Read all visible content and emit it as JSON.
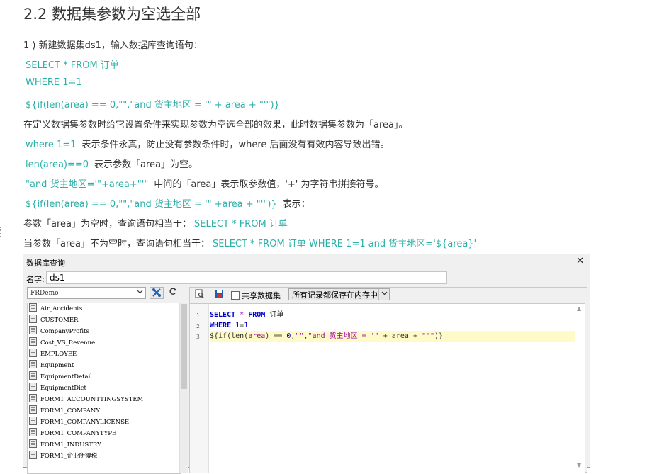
{
  "heading": "2.2 数据集参数为空选全部",
  "step1": "1 ) 新建数据集ds1，输入数据库查询语句：",
  "sql_lines": [
    "SELECT * FROM 订单",
    "WHERE 1=1",
    "${if(len(area) == 0,\"\",\"and 货主地区 = '\" + area + \"'\")}"
  ],
  "p_define": "在定义数据集参数时给它设置条件来实现参数为空选全部的效果，此时数据集参数为「area」。",
  "p_where_code": "where 1=1",
  "p_where_text": "表示条件永真，防止没有参数条件时，where 后面没有有效内容导致出错。",
  "p_len_code": "len(area)==0",
  "p_len_text": "表示参数「area」为空。",
  "p_and_code": "\"and 货主地区='\"+area+\"'\"",
  "p_and_text": "中间的「area」表示取参数值，'+' 为字符串拼接符号。",
  "p_if_code": "${if(len(area) == 0,\"\",\"and 货主地区 = '\" +area + \"'\")}",
  "p_if_text": "表示：",
  "p_empty_text": "参数「area」为空时，查询语句相当于：",
  "p_empty_code": "SELECT * FROM 订单",
  "p_nonempty_text": "当参数「area」不为空时，查询语句相当于：",
  "p_nonempty_code": "SELECT * FROM 订单 WHERE 1=1 and 货主地区='${area}'",
  "dialog": {
    "title": "数据库查询",
    "close": "✕",
    "name_label": "名字:",
    "name_value": "ds1",
    "datasource": "FRDemo",
    "share_label": "共享数据集",
    "memory_option": "所有记录都保存在内存中",
    "tables": [
      "Air_Accidents",
      "CUSTOMER",
      "CompanyProfits",
      "Cost_VS_Revenue",
      "EMPLOYEE",
      "Equipment",
      "EquipmentDetail",
      "EquipmentDict",
      "FORM1_ACCOUNTTINGSYSTEM",
      "FORM1_COMPANY",
      "FORM1_COMPANYLICENSE",
      "FORM1_COMPANYTYPE",
      "FORM1_INDUSTRY",
      "FORM1_企业所得税"
    ],
    "line_numbers": [
      "1",
      "2",
      "3"
    ],
    "icons": [
      "table-icon",
      "connection-icon",
      "refresh-icon",
      "preview-icon",
      "save-icon",
      "dropdown-arrow-icon"
    ]
  },
  "colors": {
    "code": "#2bb0a8",
    "highlight": "#fffbc8",
    "keyword": "#0000cc",
    "string": "#a000a0"
  }
}
